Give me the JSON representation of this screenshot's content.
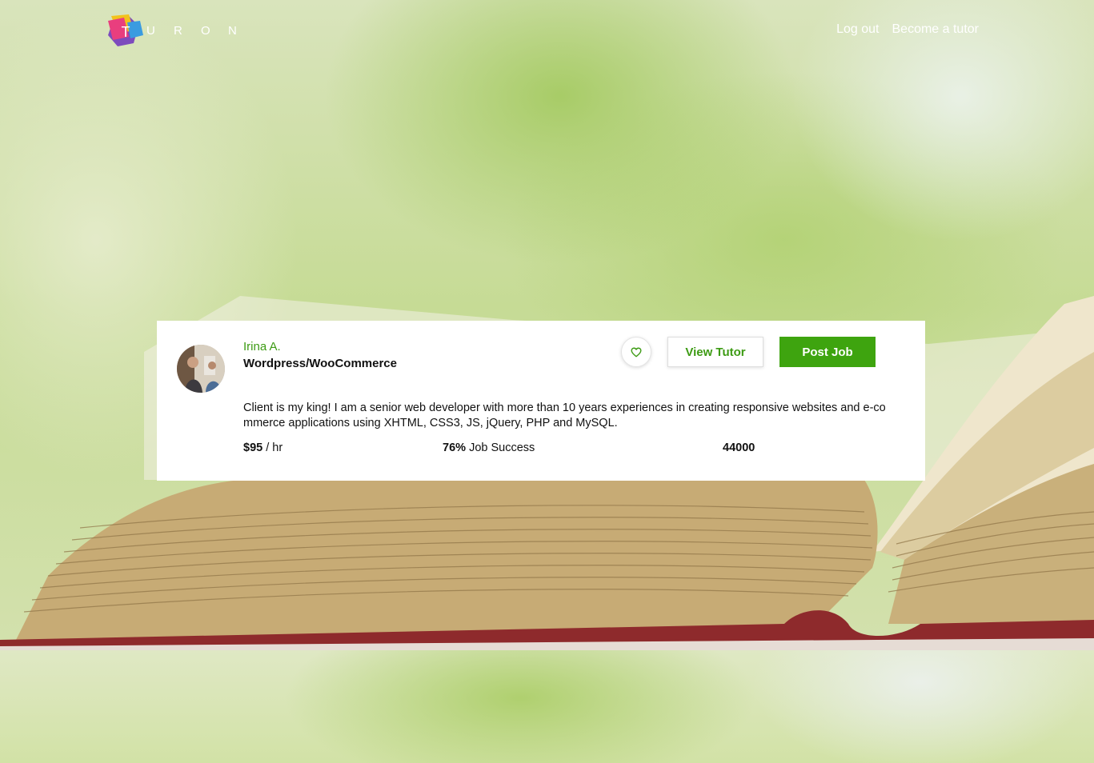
{
  "header": {
    "logo_mark_letter": "T",
    "logo_letters": [
      "U",
      "R",
      "O",
      "N"
    ],
    "nav": {
      "logout": "Log out",
      "become_tutor": "Become a tutor"
    }
  },
  "tutor_card": {
    "name": "Irina A.",
    "title": "Wordpress/WooCommerce",
    "favorite_icon": "heart-outline-icon",
    "view_button": "View Tutor",
    "post_button": "Post Job",
    "description": "Client is my king! I am a senior web developer with more than 10 years experiences in creating responsive websites and e-commerce applications using XHTML, CSS3, JS, jQuery, PHP and MySQL.",
    "rate_value": "$95",
    "rate_unit": "/ hr",
    "success_value": "76%",
    "success_label": "Job Success",
    "count": "44000"
  },
  "colors": {
    "accent_green": "#3ea40f",
    "name_green": "#3d9b14"
  }
}
